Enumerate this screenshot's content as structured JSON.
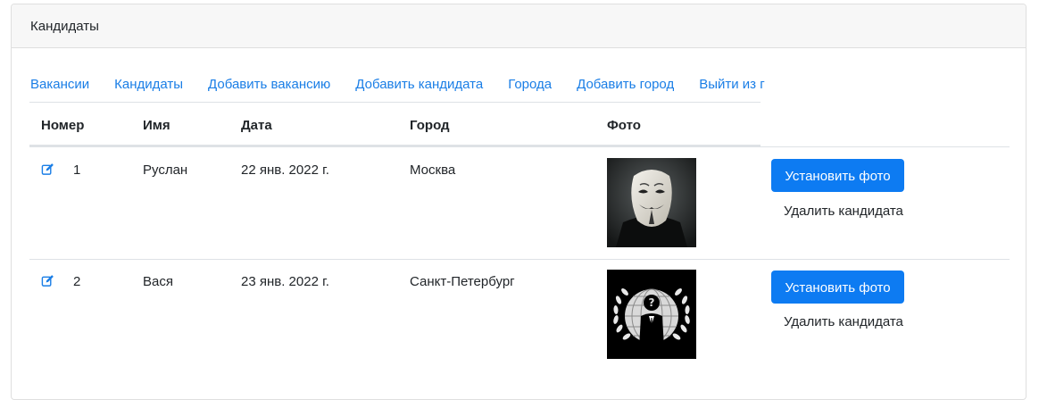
{
  "card": {
    "title": "Кандидаты"
  },
  "nav": {
    "items": [
      {
        "label": "Вакансии"
      },
      {
        "label": "Кандидаты"
      },
      {
        "label": "Добавить вакансию"
      },
      {
        "label": "Добавить кандидата"
      },
      {
        "label": "Города"
      },
      {
        "label": "Добавить город"
      },
      {
        "label": "Выйти из г"
      }
    ]
  },
  "table": {
    "headers": {
      "number": "Номер",
      "name": "Имя",
      "date": "Дата",
      "city": "Город",
      "photo": "Фото"
    },
    "rows": [
      {
        "number": "1",
        "name": "Руслан",
        "date": "22 янв. 2022 г.",
        "city": "Москва",
        "photo_icon": "mask-photo",
        "set_photo_label": "Установить фото",
        "delete_label": "Удалить кандидата"
      },
      {
        "number": "2",
        "name": "Вася",
        "date": "23 янв. 2022 г.",
        "city": "Санкт-Петербург",
        "photo_icon": "anonymous-logo-photo",
        "set_photo_label": "Установить фото",
        "delete_label": "Удалить кандидата"
      }
    ]
  },
  "colors": {
    "link": "#1a7ee6",
    "button": "#0d7bf2",
    "header_bg": "#f7f7f7"
  }
}
